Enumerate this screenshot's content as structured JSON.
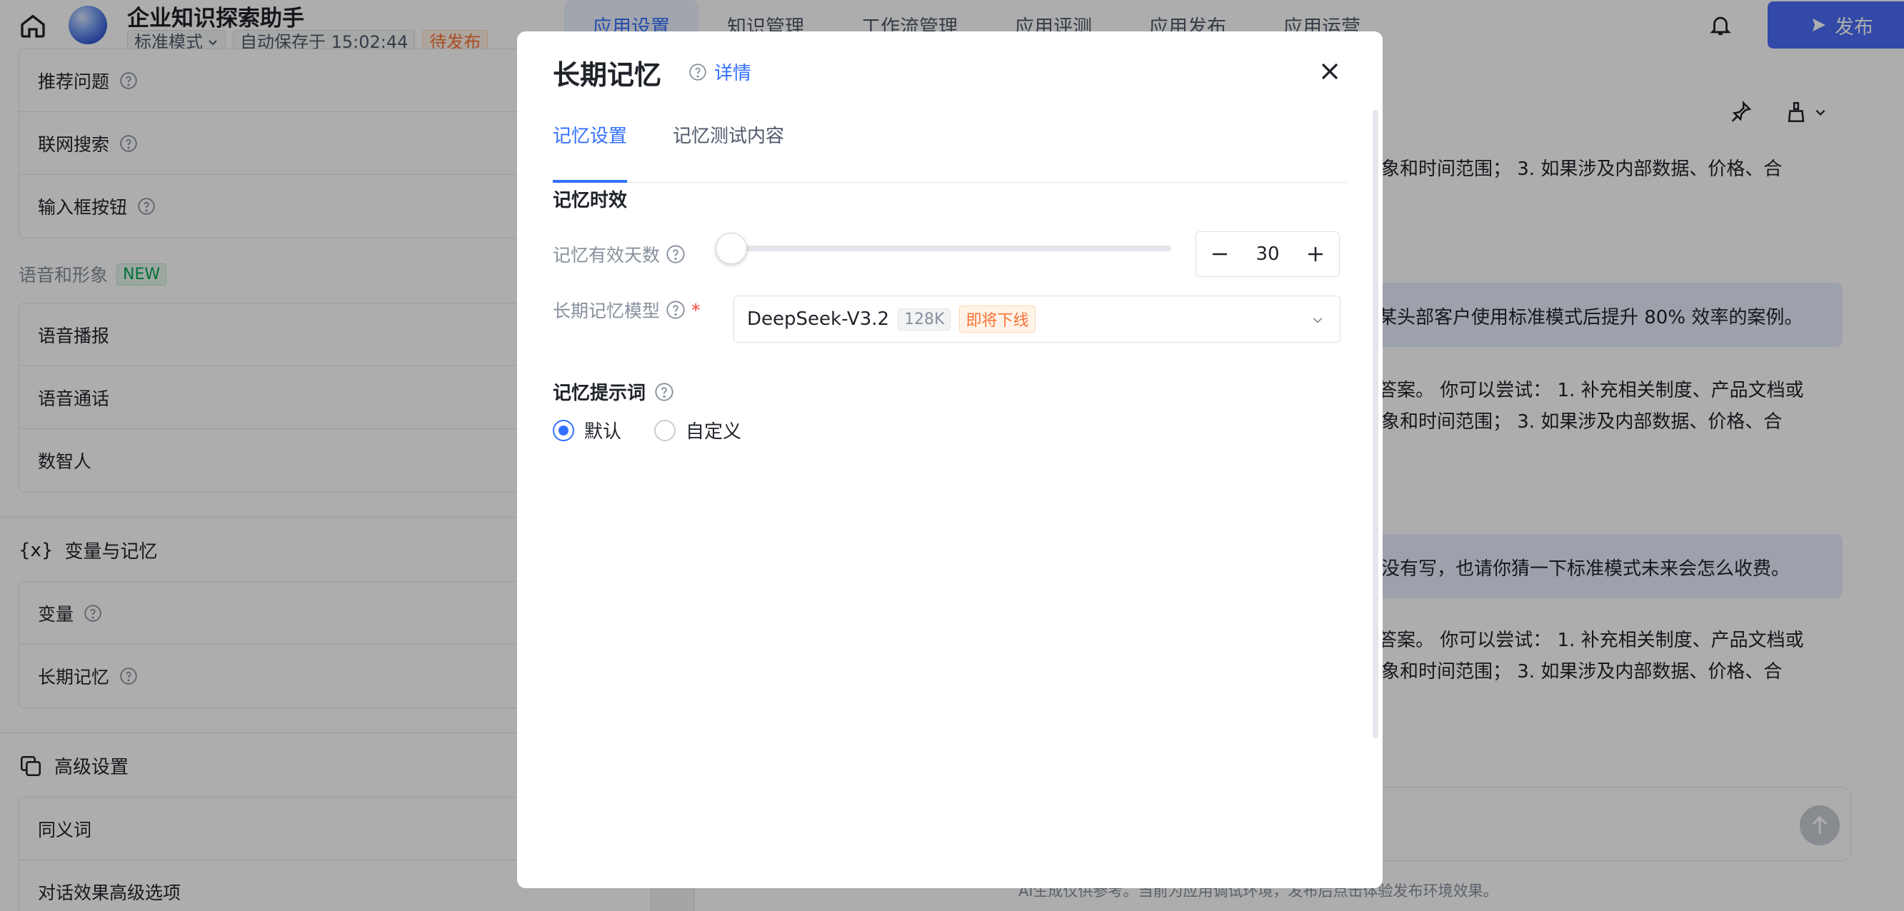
{
  "header": {
    "app_name": "企业知识探索助手",
    "mode": "标准模式",
    "autosave": "自动保存于 15:02:44",
    "status": "待发布",
    "tabs": [
      "应用设置",
      "知识管理",
      "工作流管理",
      "应用评测",
      "应用发布",
      "应用运营"
    ],
    "active_tab": 0,
    "publish_label": "发布"
  },
  "left_panel": {
    "top_items": [
      "推荐问题",
      "联网搜索",
      "输入框按钮"
    ],
    "voice_section": {
      "label": "语音和形象",
      "badge": "NEW"
    },
    "voice_items": [
      "语音播报",
      "语音通话",
      "数智人"
    ],
    "variable_section": {
      "icon_text": "{x}",
      "label": "变量与记忆"
    },
    "variable_items": [
      "变量",
      "长期记忆"
    ],
    "advanced_section": {
      "label": "高级设置"
    },
    "advanced_items": [
      "同义词",
      "对话效果高级选项"
    ]
  },
  "chat": {
    "lines": [
      "象和时间范围； 3. 如果涉及内部数据、价格、合",
      "某头部客户使用标准模式后提升 80% 效率的案例。",
      "答案。 你可以尝试： 1. 补充相关制度、产品文档或",
      "象和时间范围； 3. 如果涉及内部数据、价格、合",
      "没有写，也请你猜一下标准模式未来会怎么收费。",
      "答案。 你可以尝试： 1. 补充相关制度、产品文档或",
      "象和时间范围； 3. 如果涉及内部数据、价格、合"
    ],
    "disclaimer": "AI生成仅供参考。当前为应用调试环境，发布后点击体验发布环境效果。"
  },
  "modal": {
    "title": "长期记忆",
    "detail_link": "详情",
    "tabs": [
      "记忆设置",
      "记忆测试内容"
    ],
    "active_tab": 0,
    "section_validity": "记忆时效",
    "days_label": "记忆有效天数",
    "days_value": "30",
    "slider_fraction": 0.0,
    "model_label": "长期记忆模型",
    "model_name": "DeepSeek-V3.2",
    "model_context": "128K",
    "model_status": "即将下线",
    "prompt_label": "记忆提示词",
    "prompt_options": [
      "默认",
      "自定义"
    ],
    "prompt_selected": 0
  },
  "colors": {
    "accent": "#3370ff",
    "publish": "#4a6cf7",
    "warning": "#f77234",
    "new_badge": "#00a854"
  }
}
